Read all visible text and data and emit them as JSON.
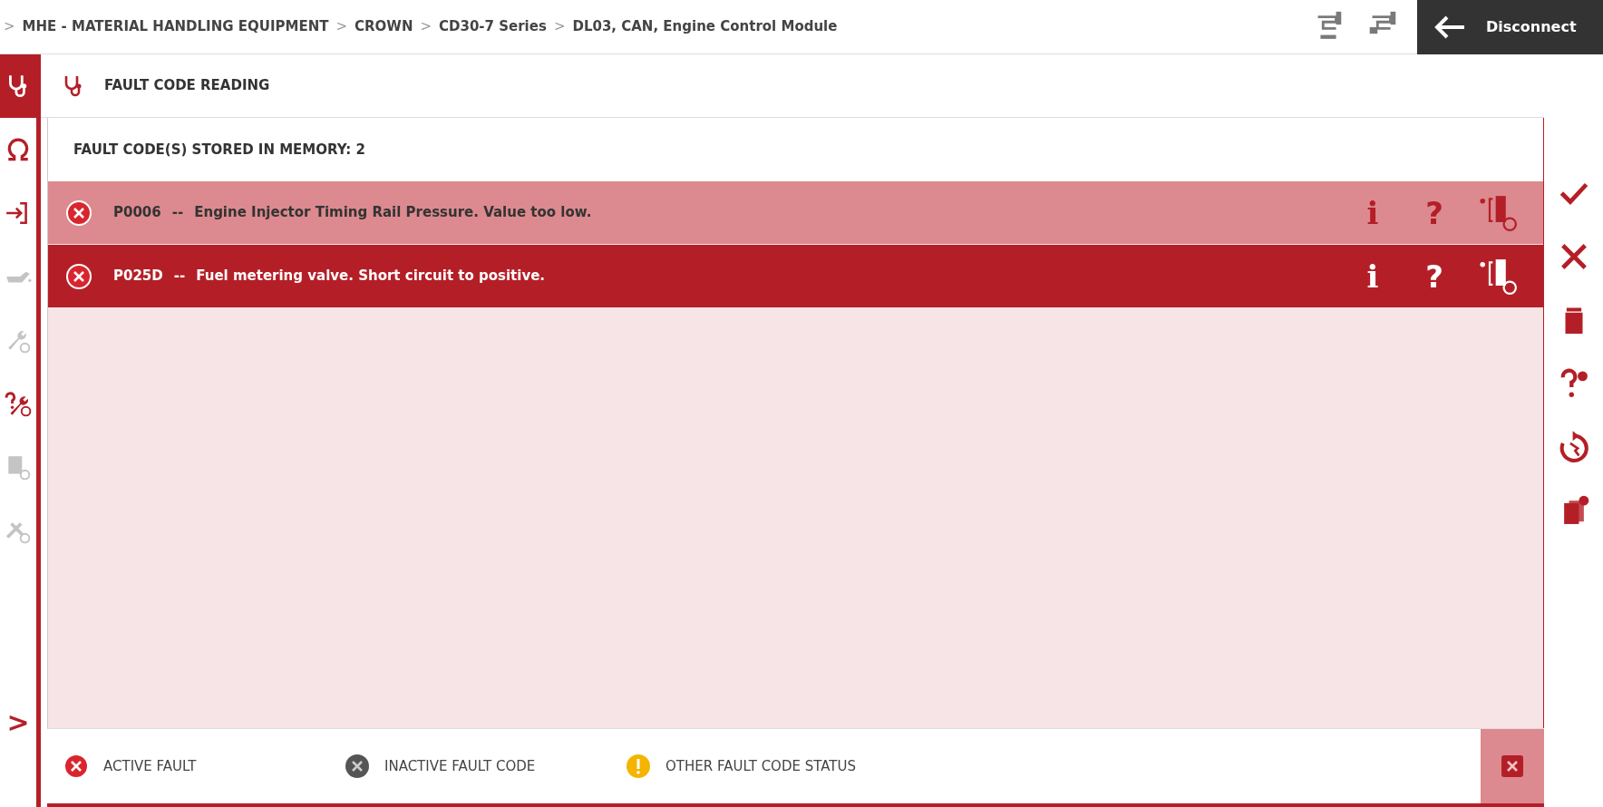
{
  "breadcrumb": [
    {
      "separator": ">",
      "label": "MHE - MATERIAL HANDLING EQUIPMENT"
    },
    {
      "separator": ">",
      "label": "CROWN"
    },
    {
      "separator": ">",
      "label": "CD30-7 Series"
    },
    {
      "separator": ">",
      "label": "DL03, CAN, Engine Control Module"
    }
  ],
  "top_tools": [
    {
      "kind": "test-plug",
      "disabled": true
    },
    {
      "kind": "plug",
      "disabled": true
    }
  ],
  "disconnect_button": {
    "label": "Disconnect"
  },
  "sidebar": {
    "items": [
      {
        "kind": "stethoscope",
        "selected": true,
        "disabled": false
      },
      {
        "kind": "omega",
        "selected": false,
        "disabled": false
      },
      {
        "kind": "arrow-bracket",
        "selected": false,
        "disabled": false
      },
      {
        "kind": "oil-can",
        "selected": false,
        "disabled": true
      },
      {
        "kind": "wrench-globe",
        "selected": false,
        "disabled": true
      },
      {
        "kind": "help-wrench-globe",
        "selected": false,
        "disabled": false
      },
      {
        "kind": "document-globe",
        "selected": false,
        "disabled": true
      },
      {
        "kind": "wrenches-globe",
        "selected": false,
        "disabled": true
      }
    ],
    "expand": {
      "glyph": ">"
    }
  },
  "panel": {
    "title": "FAULT CODE READING"
  },
  "fault_count": "FAULT CODE(S) STORED IN MEMORY: 2",
  "faults": [
    {
      "kind": "active",
      "code": "P0006",
      "separator": "--",
      "description": "Engine Injector Timing Rail Pressure. Value too low.",
      "selected": false,
      "info_glyph": "i",
      "help_glyph": "?"
    },
    {
      "kind": "active",
      "code": "P025D",
      "separator": "--",
      "description": "Fuel metering valve. Short circuit to positive.",
      "selected": true,
      "info_glyph": "i",
      "help_glyph": "?"
    }
  ],
  "toolbar": [
    {
      "kind": "check"
    },
    {
      "kind": "close"
    },
    {
      "kind": "trash"
    },
    {
      "kind": "help-add"
    },
    {
      "kind": "reset"
    },
    {
      "kind": "documents"
    }
  ],
  "legend": [
    {
      "kind": "active",
      "label": "ACTIVE FAULT"
    },
    {
      "kind": "inactive",
      "label": "INACTIVE FAULT CODE"
    },
    {
      "kind": "other",
      "label": "OTHER FAULT CODE STATUS"
    }
  ]
}
